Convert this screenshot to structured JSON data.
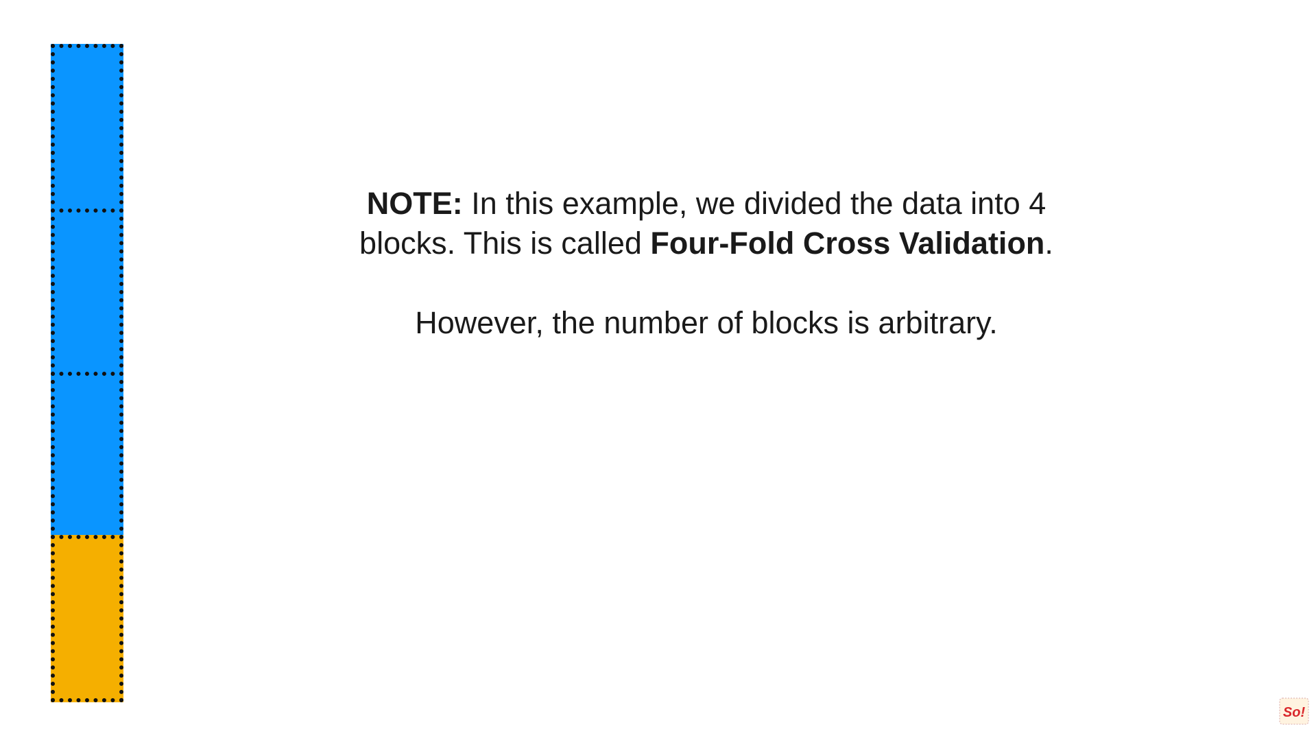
{
  "diagram": {
    "blocks": [
      {
        "color": "#0a95ff"
      },
      {
        "color": "#0a95ff"
      },
      {
        "color": "#0a95ff"
      },
      {
        "color": "#f5af00"
      }
    ],
    "border_color": "#111111"
  },
  "note": {
    "line1_label": "NOTE:",
    "line1_text": " In this example, we divided the data into 4",
    "line2_text": "blocks. This is called ",
    "line2_bold": "Four-Fold Cross Validation",
    "line2_end": ".",
    "line3_text": "However, the number of blocks is arbitrary."
  },
  "logo": {
    "text": "So!",
    "icon": "statquest-logo-icon"
  }
}
